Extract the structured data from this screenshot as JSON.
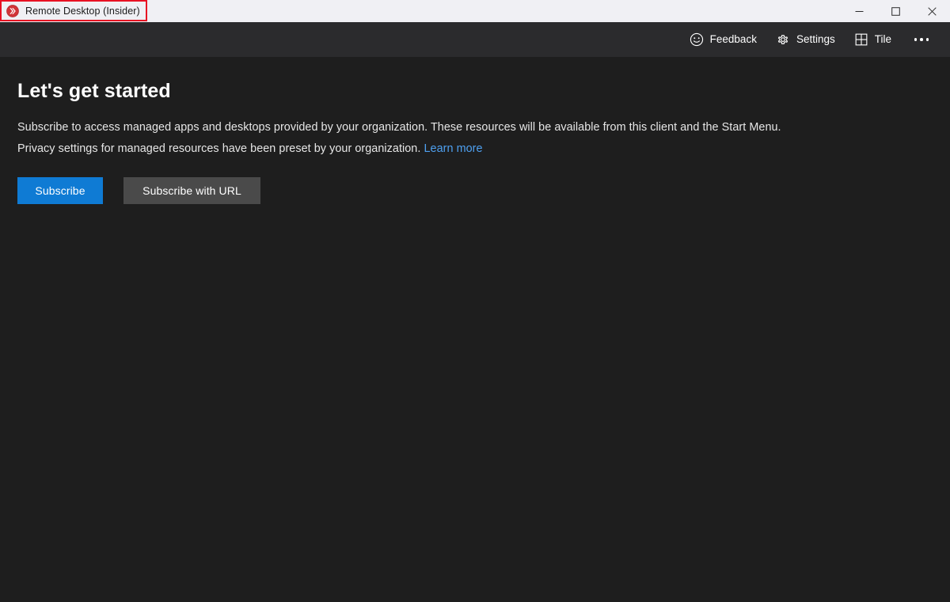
{
  "window": {
    "title": "Remote Desktop (Insider)",
    "app_icon": "remote-desktop-icon",
    "controls": {
      "minimize": "Minimize",
      "maximize": "Maximize",
      "close": "Close"
    }
  },
  "annotation": {
    "color": "#e81123",
    "target": "window-title"
  },
  "toolbar": {
    "items": [
      {
        "label": "Feedback",
        "icon": "smiley-face-icon"
      },
      {
        "label": "Settings",
        "icon": "gear-icon"
      },
      {
        "label": "Tile",
        "icon": "tile-grid-icon"
      }
    ],
    "more_label": "More options",
    "more_icon": "ellipsis-icon"
  },
  "main": {
    "heading": "Let's get started",
    "paragraph_1": "Subscribe to access managed apps and desktops provided by your organization. These resources will be available from this client and the Start Menu.",
    "paragraph_2_text": "Privacy settings for managed resources have been preset by your organization.",
    "learn_more_label": "Learn more",
    "buttons": {
      "subscribe": "Subscribe",
      "subscribe_with_url": "Subscribe with URL"
    }
  },
  "colors": {
    "titlebar_background": "#f0f0f4",
    "toolbar_background": "#2b2b2d",
    "content_background": "#1e1e1e",
    "accent_blue": "#0f7bd4",
    "link_blue": "#4ea0f0",
    "secondary_button": "#4a4a4a",
    "annotation_red": "#e81123",
    "app_icon_red": "#d13438"
  }
}
